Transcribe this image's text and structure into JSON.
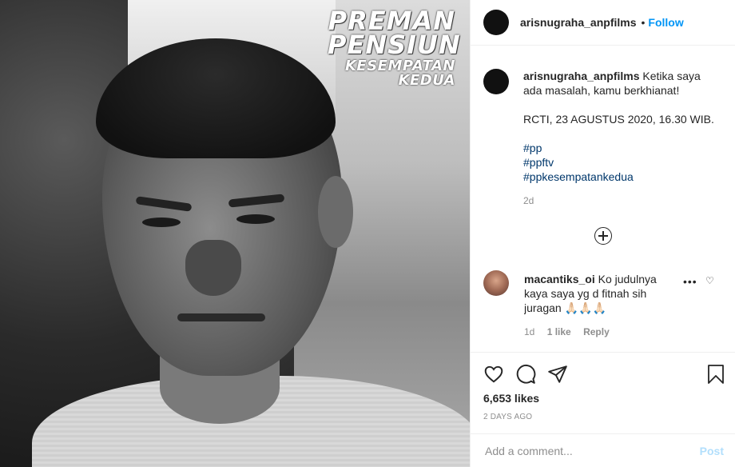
{
  "photo": {
    "title_line1": "PREMAN",
    "title_line2": "PENSIUN",
    "title_line3": "KESEMPATAN KEDUA"
  },
  "header": {
    "username": "arisnugraha_anpfilms",
    "separator": "•",
    "follow_label": "Follow"
  },
  "caption": {
    "username": "arisnugraha_anpfilms",
    "text": "Ketika saya ada masalah, kamu berkhianat!",
    "schedule": "RCTI, 23 AGUSTUS 2020, 16.30 WIB.",
    "hashtags": [
      "#pp",
      "#ppftv",
      "#ppkesempatankedua"
    ],
    "time": "2d"
  },
  "comment": {
    "username": "macantiks_oi",
    "text": "Ko judulnya kaya saya yg d fitnah sih juragan 🙏🏻🙏🏻🙏🏻",
    "more": "•••",
    "heart": "♡",
    "time": "1d",
    "likes": "1 like",
    "reply": "Reply"
  },
  "actions": {
    "icons": [
      "heart-icon",
      "comment-icon",
      "share-icon",
      "bookmark-icon"
    ],
    "likes": "6,653 likes",
    "date": "2 DAYS AGO"
  },
  "add_comment": {
    "placeholder": "Add a comment...",
    "post_label": "Post"
  },
  "colors": {
    "link": "#0095f6",
    "hashtag": "#00376b",
    "muted": "#8e8e8e",
    "post_disabled": "#b2dffc"
  }
}
